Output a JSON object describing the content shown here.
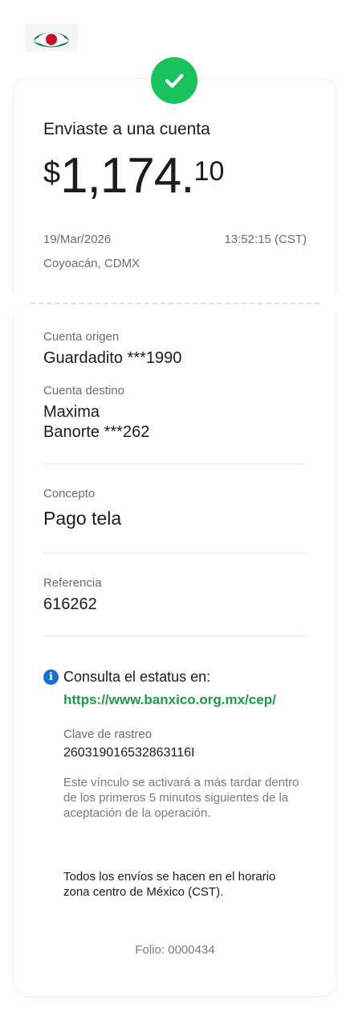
{
  "header": {
    "logo_icon": "banco-logo-icon"
  },
  "status": {
    "icon": "check-icon",
    "color": "#19c25c"
  },
  "transfer": {
    "title": "Enviaste a una cuenta",
    "currency_symbol": "$",
    "amount_integer": "1,174.",
    "amount_decimals": "10",
    "date": "19/Mar/2026",
    "time": "13:52:15 (CST)",
    "location": "Coyoacán, CDMX"
  },
  "origin": {
    "label": "Cuenta origen",
    "value": "Guardadito ***1990"
  },
  "destination": {
    "label": "Cuenta destino",
    "name": "Maxima",
    "account": "Banorte ***262"
  },
  "concept": {
    "label": "Concepto",
    "value": "Pago tela"
  },
  "reference": {
    "label": "Referencia",
    "value": "616262"
  },
  "status_info": {
    "icon": "info-icon",
    "text": "Consulta el estatus en:",
    "link": "https://www.banxico.org.mx/cep/",
    "link_color": "#1e9a4a",
    "tracking_label": "Clave de rastreo",
    "tracking_value": "260319016532863116I",
    "note": "Este vínculo se activará a más tardar dentro de los primeros 5 minutos siguientes de la aceptación de la operación.",
    "schedule_note": "Todos los envíos se hacen en el horario zona centro de México (CST)."
  },
  "footer": {
    "folio": "Folio: 0000434"
  }
}
